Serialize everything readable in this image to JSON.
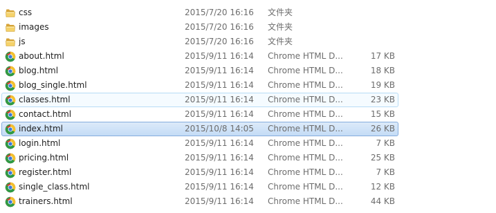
{
  "files": [
    {
      "name": "css",
      "date": "2015/7/20 16:16",
      "type": "文件夹",
      "size": "",
      "icon": "folder-icon",
      "state": ""
    },
    {
      "name": "images",
      "date": "2015/7/20 16:16",
      "type": "文件夹",
      "size": "",
      "icon": "folder-icon",
      "state": ""
    },
    {
      "name": "js",
      "date": "2015/7/20 16:16",
      "type": "文件夹",
      "size": "",
      "icon": "folder-icon",
      "state": ""
    },
    {
      "name": "about.html",
      "date": "2015/9/11 16:14",
      "type": "Chrome HTML D...",
      "size": "17 KB",
      "icon": "chrome-icon",
      "state": ""
    },
    {
      "name": "blog.html",
      "date": "2015/9/11 16:14",
      "type": "Chrome HTML D...",
      "size": "18 KB",
      "icon": "chrome-icon",
      "state": ""
    },
    {
      "name": "blog_single.html",
      "date": "2015/9/11 16:14",
      "type": "Chrome HTML D...",
      "size": "19 KB",
      "icon": "chrome-icon",
      "state": ""
    },
    {
      "name": "classes.html",
      "date": "2015/9/11 16:14",
      "type": "Chrome HTML D...",
      "size": "23 KB",
      "icon": "chrome-icon",
      "state": "hover"
    },
    {
      "name": "contact.html",
      "date": "2015/9/11 16:14",
      "type": "Chrome HTML D...",
      "size": "15 KB",
      "icon": "chrome-icon",
      "state": ""
    },
    {
      "name": "index.html",
      "date": "2015/10/8 14:05",
      "type": "Chrome HTML D...",
      "size": "26 KB",
      "icon": "chrome-icon",
      "state": "selected"
    },
    {
      "name": "login.html",
      "date": "2015/9/11 16:14",
      "type": "Chrome HTML D...",
      "size": "7 KB",
      "icon": "chrome-icon",
      "state": ""
    },
    {
      "name": "pricing.html",
      "date": "2015/9/11 16:14",
      "type": "Chrome HTML D...",
      "size": "25 KB",
      "icon": "chrome-icon",
      "state": ""
    },
    {
      "name": "register.html",
      "date": "2015/9/11 16:14",
      "type": "Chrome HTML D...",
      "size": "7 KB",
      "icon": "chrome-icon",
      "state": ""
    },
    {
      "name": "single_class.html",
      "date": "2015/9/11 16:14",
      "type": "Chrome HTML D...",
      "size": "12 KB",
      "icon": "chrome-icon",
      "state": ""
    },
    {
      "name": "trainers.html",
      "date": "2015/9/11 16:14",
      "type": "Chrome HTML D...",
      "size": "44 KB",
      "icon": "chrome-icon",
      "state": ""
    }
  ],
  "colors": {
    "hover_border": "#b7dcf5",
    "selected_border": "#84acdd",
    "selected_fill": "#c4dcf6",
    "meta_text": "#6d6d6d"
  }
}
